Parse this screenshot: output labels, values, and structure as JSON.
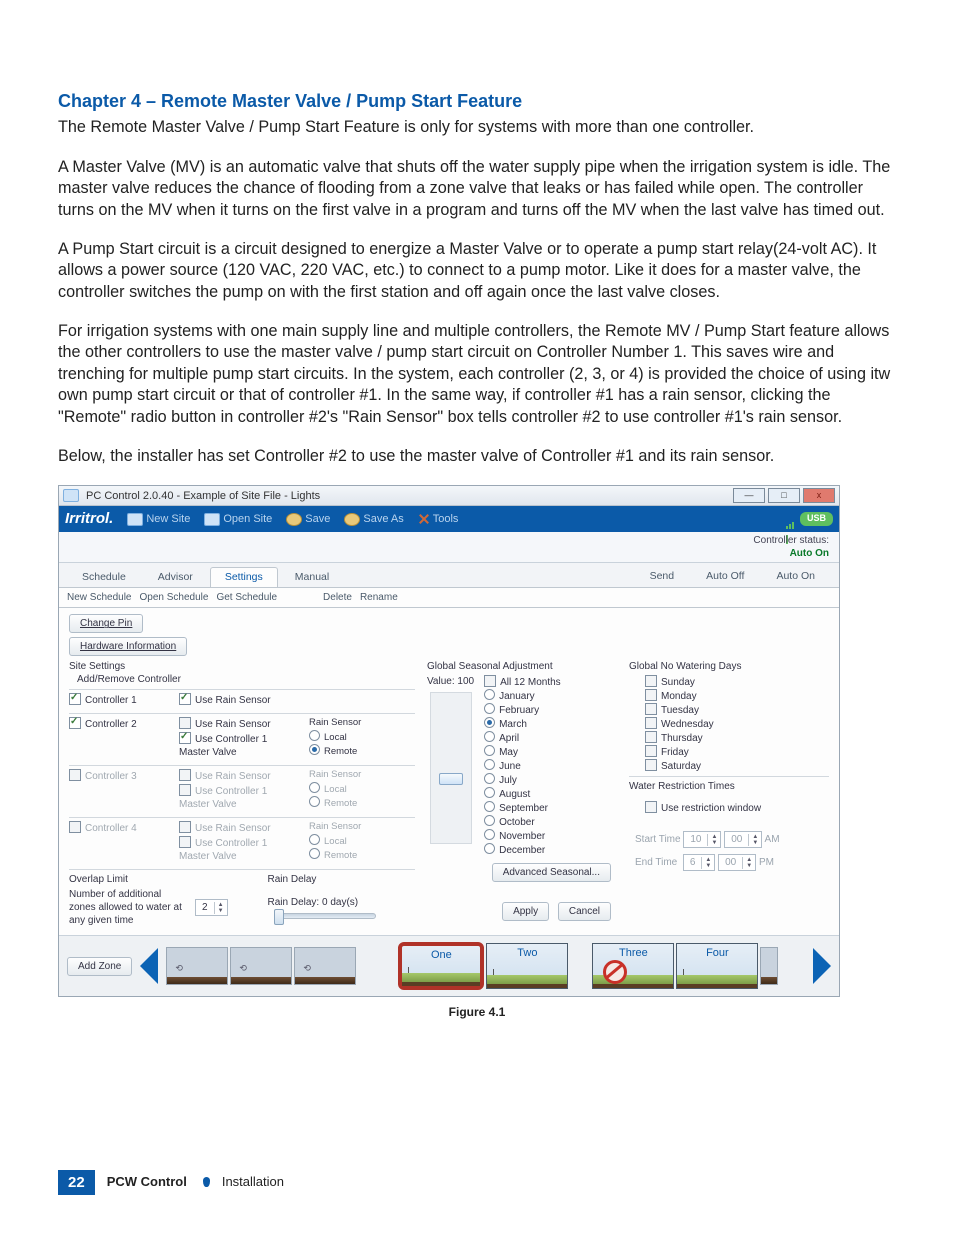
{
  "heading": "Chapter 4 – Remote Master Valve / Pump Start Feature",
  "para1": "The Remote Master Valve / Pump Start Feature is only for systems with more than one controller.",
  "para2": "A Master Valve (MV) is an automatic valve that shuts off the water supply pipe when the irrigation system is idle. The master valve reduces the chance of flooding from a zone valve that leaks or has failed while open. The controller turns on the MV when it turns on the first valve in a program and turns off the MV when the last valve has timed out.",
  "para3": "A Pump Start circuit is a circuit designed to energize a Master Valve or to operate a pump start relay(24-volt AC). It allows a power source (120 VAC, 220 VAC, etc.) to connect to a pump motor. Like it does for a master valve, the controller switches the pump on with the first station and off again once the last valve closes.",
  "para4": "For irrigation systems with one main supply line and multiple controllers, the Remote MV / Pump Start feature allows the other controllers to use the master valve / pump start circuit on Controller Number 1. This saves wire and trenching for multiple pump start circuits. In the system, each controller (2, 3, or 4) is provided the choice of using itw own pump start circuit or that of controller #1. In the same way, if controller #1 has a rain sensor, clicking the \"Remote\" radio button in controller #2's \"Rain Sensor\" box tells controller #2 to use controller #1's rain sensor.",
  "para5": "Below, the installer has set Controller #2 to use the master valve of Controller #1 and its rain sensor.",
  "figure_caption": "Figure 4.1",
  "page_number": "22",
  "footer_title": "PCW Control",
  "footer_section": "Installation",
  "win": {
    "title": "PC Control 2.0.40 - Example of Site File - Lights",
    "ctl": {
      "min": "—",
      "max": "□",
      "close": "x"
    },
    "logo": "Irritrol.",
    "menu": [
      "New Site",
      "Open Site",
      "Save",
      "Save As",
      "Tools"
    ],
    "usb_badge": "USB",
    "status_label": "Controller status:",
    "status_value": "Auto On",
    "tabs": [
      "Schedule",
      "Advisor",
      "Settings",
      "Manual"
    ],
    "rtabs": [
      "Send",
      "Auto Off",
      "Auto On"
    ],
    "subbar": [
      "New Schedule",
      "Open Schedule",
      "Get Schedule",
      "Delete",
      "Rename"
    ],
    "change_pin": "Change Pin",
    "hw_info": "Hardware Information",
    "site_settings": "Site Settings",
    "add_remove": "Add/Remove Controller",
    "controllers": [
      {
        "name": "Controller 1",
        "enabled": true,
        "use_rain": true,
        "show_master": false
      },
      {
        "name": "Controller 2",
        "enabled": true,
        "use_rain": false,
        "rain_label": "Rain Sensor",
        "use_c1": true,
        "local": "Local",
        "remote": "Remote",
        "remote_sel": true,
        "dim": false
      },
      {
        "name": "Controller 3",
        "enabled": false,
        "use_rain": false,
        "rain_label": "Rain Sensor",
        "use_c1": false,
        "local": "Local",
        "remote": "Remote",
        "remote_sel": false,
        "dim": true
      },
      {
        "name": "Controller 4",
        "enabled": false,
        "use_rain": false,
        "rain_label": "Rain Sensor",
        "use_c1": false,
        "local": "Local",
        "remote": "Remote",
        "remote_sel": false,
        "dim": true
      }
    ],
    "use_rain_label": "Use Rain Sensor",
    "use_c1_label": "Use Controller 1\nMaster Valve",
    "overlap_title": "Overlap Limit",
    "overlap_desc": "Number of additional zones allowed to water at any given time",
    "overlap_val": "2",
    "rain_delay_title": "Rain Delay",
    "rain_delay_text": "Rain Delay: 0 day(s)",
    "gsa_title": "Global Seasonal Adjustment",
    "gsa_value_label": "Value:",
    "gsa_value": "100",
    "all_months": "All 12 Months",
    "months": [
      "January",
      "February",
      "March",
      "April",
      "May",
      "June",
      "July",
      "August",
      "September",
      "October",
      "November",
      "December"
    ],
    "month_selected": "March",
    "adv_seasonal": "Advanced Seasonal...",
    "apply": "Apply",
    "cancel": "Cancel",
    "gnw_title": "Global No Watering Days",
    "days": [
      "Sunday",
      "Monday",
      "Tuesday",
      "Wednesday",
      "Thursday",
      "Friday",
      "Saturday"
    ],
    "wrt_title": "Water Restriction Times",
    "use_restriction": "Use restriction window",
    "start_label": "Start Time",
    "start_h": "10",
    "start_m": "00",
    "start_ap": "AM",
    "end_label": "End Time",
    "end_h": "6",
    "end_m": "00",
    "end_ap": "PM",
    "add_zone": "Add Zone",
    "zones": [
      "One",
      "Two",
      "Three",
      "Four"
    ]
  }
}
